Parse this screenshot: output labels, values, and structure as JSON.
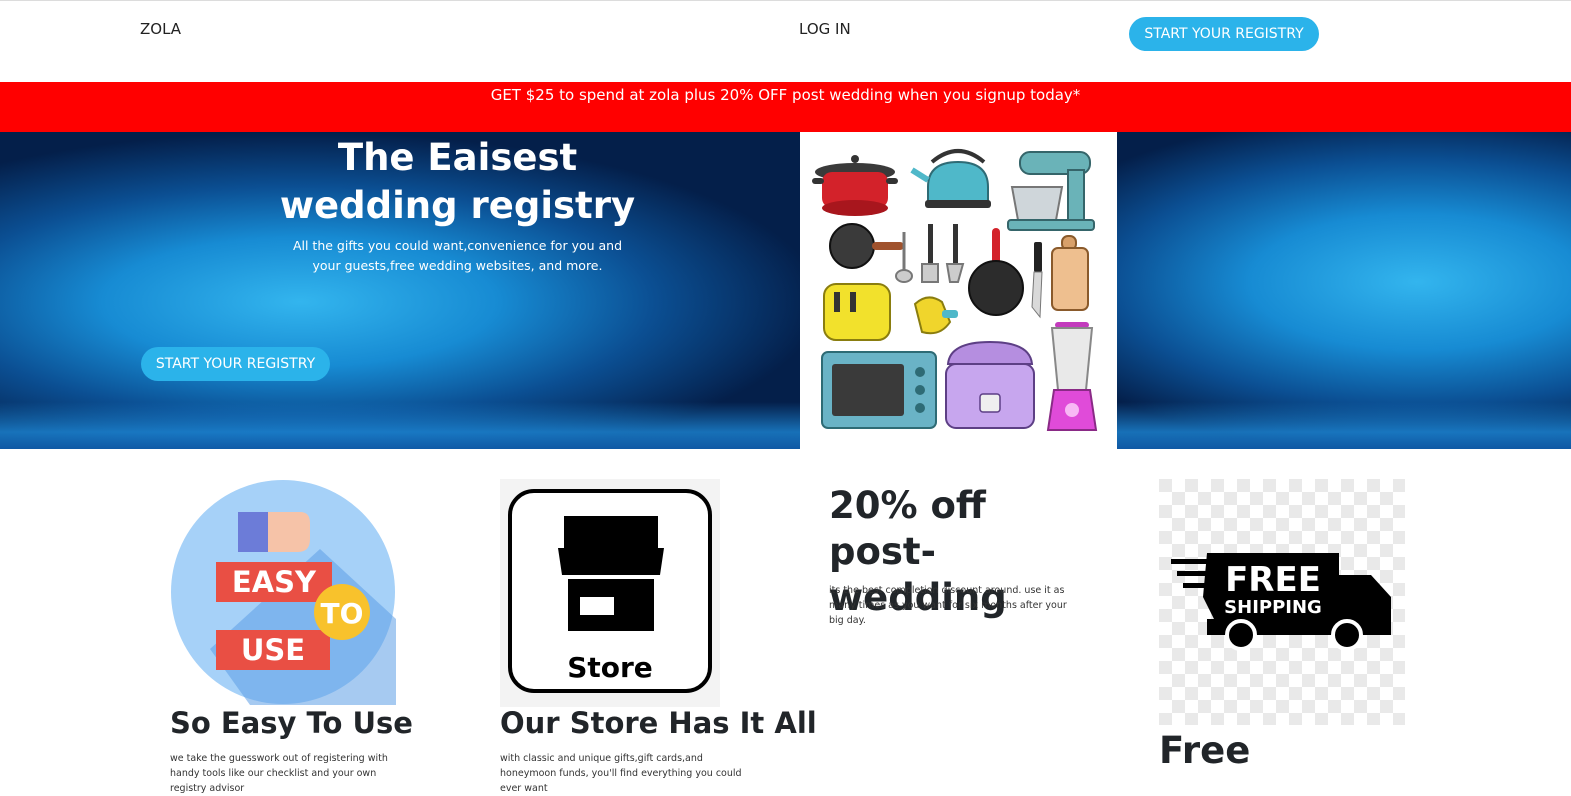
{
  "nav": {
    "brand": "ZOLA",
    "login": "LOG IN",
    "cta": "START YOUR REGISTRY"
  },
  "promo": {
    "text": "GET $25 to spend at zola plus 20% OFF post wedding when you signup today*"
  },
  "hero": {
    "title_line1": "The Eaisest",
    "title_line2": "wedding registry",
    "subtitle_line1": "All the gifts you could want,convenience for you and",
    "subtitle_line2": "your guests,free wedding websites, and more.",
    "cta": "START YOUR REGISTRY"
  },
  "features": [
    {
      "title": "So Easy To Use",
      "text": "we take the guesswork out of registering with handy tools like our checklist and your own registry advisor",
      "badge_word1": "EASY",
      "badge_word2": "TO",
      "badge_word3": "USE"
    },
    {
      "title": "Our Store Has It All",
      "text": "with classic and unique gifts,gift cards,and honeymoon funds, you'll find everything you could ever want",
      "icon_label": "Store"
    },
    {
      "title": "20% off post-wedding",
      "text": "its the best completion discount around. use it as many times as you want for six months after your big day."
    },
    {
      "title": "Free",
      "icon_text1": "FREE",
      "icon_text2": "SHIPPING"
    }
  ],
  "colors": {
    "accent": "#2bb3ea",
    "promo_bg": "#ff0000",
    "hero_dark": "#041f4a",
    "hero_light": "#33b5ee"
  }
}
